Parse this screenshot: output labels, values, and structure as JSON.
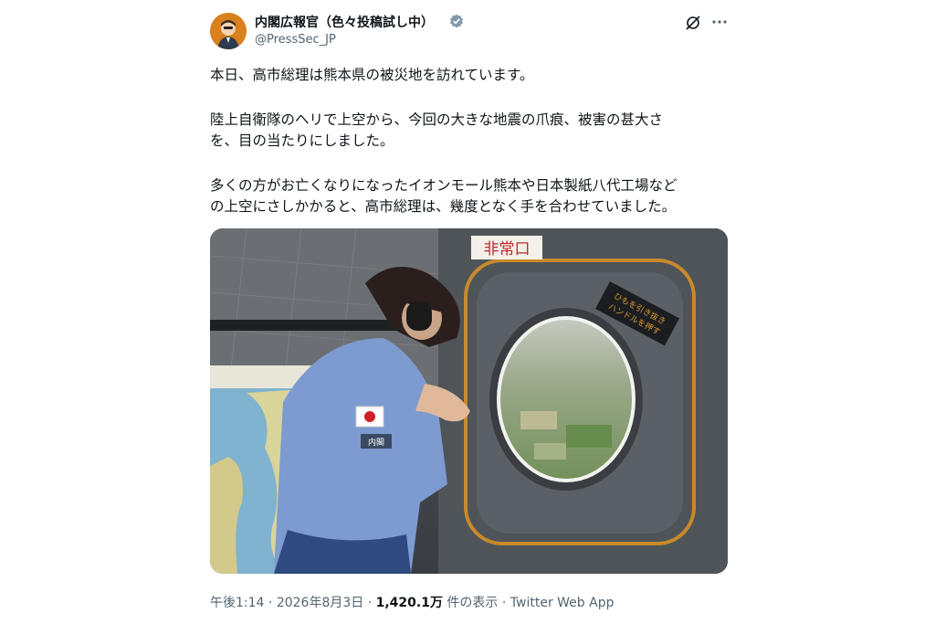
{
  "author": {
    "display_name": "内閣広報官（色々投稿試し中）",
    "handle": "@PressSec_JP"
  },
  "tweet": {
    "lines": [
      "本日、高市総理は熊本県の被災地を訪れています。",
      "陸上自衛隊のヘリで上空から、今回の大きな地震の爪痕、被害の甚大さ",
      "を、目の当たりにしました。",
      "多くの方がお亡くなりになったイオンモール熊本や日本製紙八代工場など",
      "の上空にさしかかると、高市総理は、幾度となく手を合わせていました。"
    ]
  },
  "photo": {
    "sign_emergency_exit": "非常口",
    "sign_label_line1": "ひもを引き抜き",
    "sign_label_line2": "ハンドルを押す",
    "badge_text": "内閣"
  },
  "meta": {
    "time": "午後1:14",
    "separator1": " · ",
    "date": "2026年8月3日",
    "separator2": " · ",
    "views_count": "1,420.1万",
    "views_label": " 件の表示",
    "separator3": " · ",
    "source": "Twitter Web App"
  },
  "colors": {
    "verified": "#829aab",
    "text": "#0f1419",
    "secondary": "#536471"
  },
  "icons": [
    "verified-badge-icon",
    "grok-icon",
    "more-icon"
  ]
}
